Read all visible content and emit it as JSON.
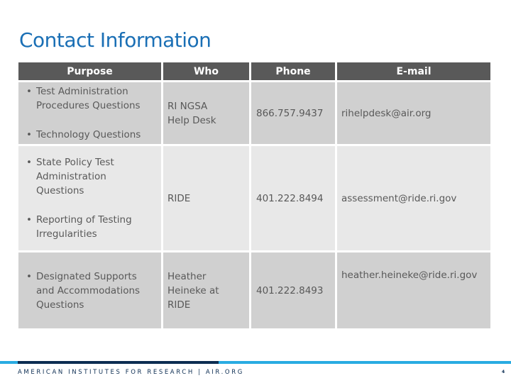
{
  "slide": {
    "title": "Contact Information",
    "colors": {
      "title": "#1a6fb5",
      "header_bg": "#595959",
      "row_dark": "#d0d0d0",
      "row_light": "#e8e8e8",
      "footer_light": "#29abe2",
      "footer_navy": "#0c2d52"
    }
  },
  "table": {
    "headers": [
      "Purpose",
      "Who",
      "Phone",
      "E-mail"
    ],
    "rows": [
      {
        "purpose": [
          "Test Administration Procedures Questions",
          "Technology Questions"
        ],
        "who": [
          "RI NGSA",
          "Help Desk"
        ],
        "phone": "866.757.9437",
        "email": "rihelpdesk@air.org"
      },
      {
        "purpose": [
          "State Policy Test Administration Questions",
          "Reporting of Testing Irregularities"
        ],
        "who": [
          "RIDE"
        ],
        "phone": "401.222.8494",
        "email": "assessment@ride.ri.gov"
      },
      {
        "purpose": [
          "Designated Supports and Accommodations Questions"
        ],
        "who": [
          "Heather",
          "Heineke at RIDE"
        ],
        "phone": "401.222.8493",
        "email": "heather.heineke@ride.ri.gov"
      }
    ],
    "bullet": "•"
  },
  "footer": {
    "text": "AMERICAN INSTITUTES FOR RESEARCH | AIR.ORG",
    "page_number": "4"
  }
}
